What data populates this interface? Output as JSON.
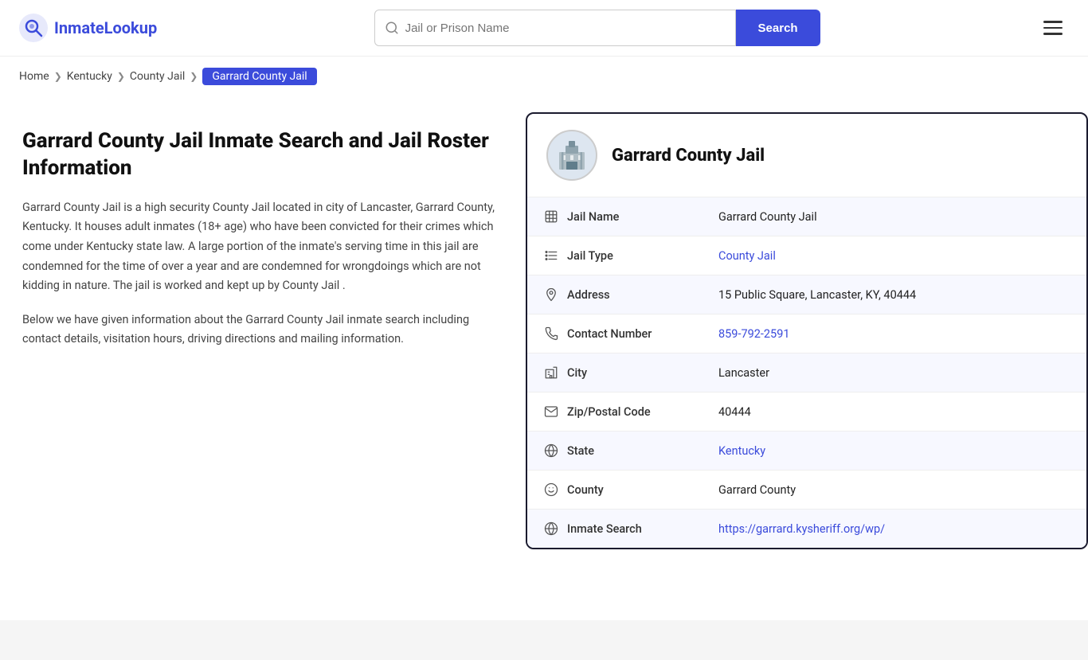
{
  "header": {
    "logo_text": "InmateLookup",
    "search_placeholder": "Jail or Prison Name",
    "search_button_label": "Search"
  },
  "breadcrumb": {
    "items": [
      {
        "label": "Home",
        "href": "#",
        "active": false
      },
      {
        "label": "Kentucky",
        "href": "#",
        "active": false
      },
      {
        "label": "County Jail",
        "href": "#",
        "active": false
      },
      {
        "label": "Garrard County Jail",
        "href": "#",
        "active": true
      }
    ]
  },
  "left": {
    "page_title": "Garrard County Jail Inmate Search and Jail Roster Information",
    "desc1": "Garrard County Jail is a high security County Jail located in city of Lancaster, Garrard County, Kentucky. It houses adult inmates (18+ age) who have been convicted for their crimes which come under Kentucky state law. A large portion of the inmate's serving time in this jail are condemned for the time of over a year and are condemned for wrongdoings which are not kidding in nature. The jail is worked and kept up by County Jail .",
    "desc2": "Below we have given information about the Garrard County Jail inmate search including contact details, visitation hours, driving directions and mailing information."
  },
  "card": {
    "facility_name": "Garrard County Jail",
    "rows": [
      {
        "label": "Jail Name",
        "value": "Garrard County Jail",
        "link": null,
        "icon": "jail-icon"
      },
      {
        "label": "Jail Type",
        "value": "County Jail",
        "link": "#",
        "icon": "list-icon"
      },
      {
        "label": "Address",
        "value": "15 Public Square, Lancaster, KY, 40444",
        "link": null,
        "icon": "pin-icon"
      },
      {
        "label": "Contact Number",
        "value": "859-792-2591",
        "link": "tel:859-792-2591",
        "icon": "phone-icon"
      },
      {
        "label": "City",
        "value": "Lancaster",
        "link": null,
        "icon": "city-icon"
      },
      {
        "label": "Zip/Postal Code",
        "value": "40444",
        "link": null,
        "icon": "mail-icon"
      },
      {
        "label": "State",
        "value": "Kentucky",
        "link": "#",
        "icon": "globe-icon"
      },
      {
        "label": "County",
        "value": "Garrard County",
        "link": null,
        "icon": "county-icon"
      },
      {
        "label": "Inmate Search",
        "value": "https://garrard.kysheriff.org/wp/",
        "link": "https://garrard.kysheriff.org/wp/",
        "icon": "search-globe-icon"
      }
    ]
  },
  "colors": {
    "accent": "#3b4bdb",
    "active_breadcrumb_bg": "#3b4bdb",
    "active_breadcrumb_text": "#ffffff"
  }
}
